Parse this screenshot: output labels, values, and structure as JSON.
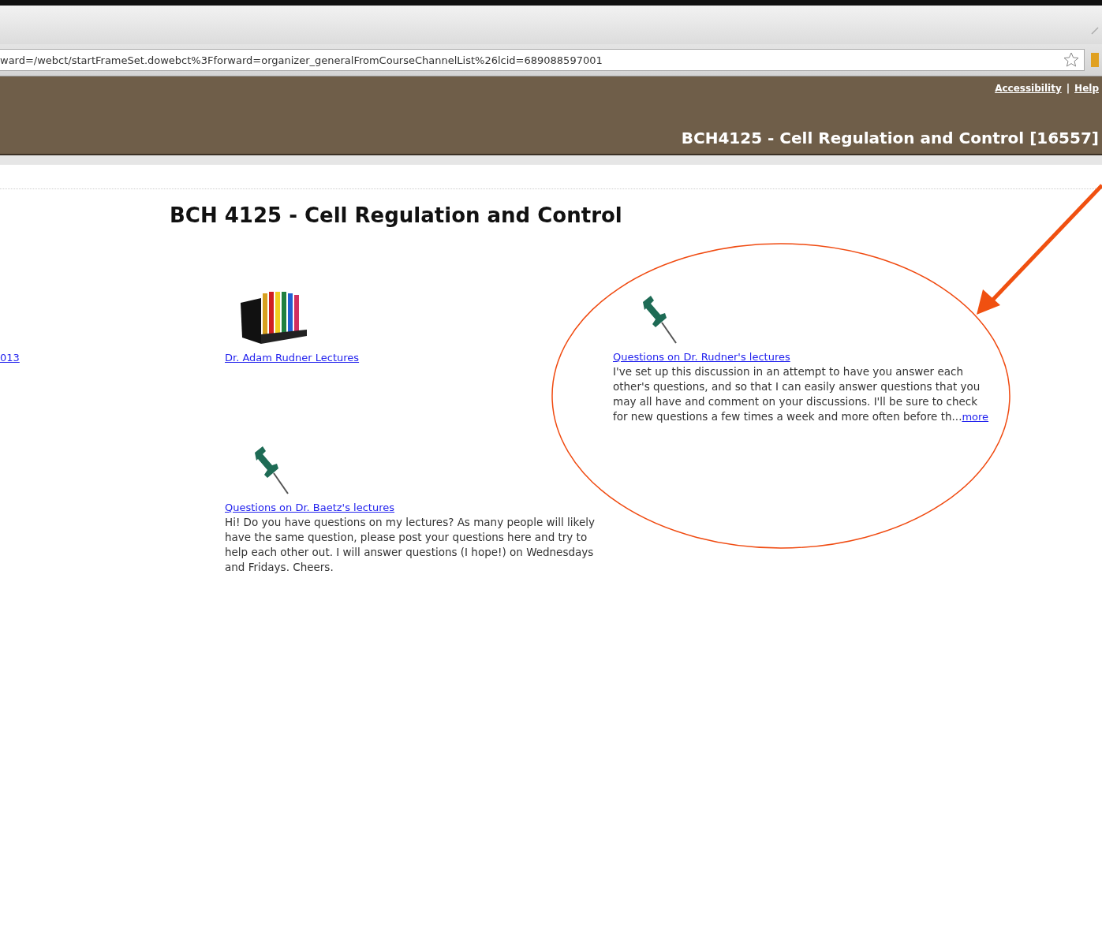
{
  "browser": {
    "address": "ward=/webct/startFrameSet.dowebct%3Fforward=organizer_generalFromCourseChannelList%26lcid=689088597001"
  },
  "header": {
    "links": [
      "Accessibility",
      "Help"
    ],
    "separator": "|",
    "course": "BCH4125 - Cell Regulation and Control [16557]"
  },
  "page_title": "BCH 4125 - Cell Regulation and Control",
  "items": [
    {
      "kind": "cut",
      "title": "013"
    },
    {
      "kind": "folder",
      "title": "Dr. Adam Rudner Lectures"
    },
    {
      "kind": "discussion",
      "title": "Questions on Dr. Rudner's lectures",
      "description": "I've set up this discussion in an attempt to have you answer each other's questions, and so that I can easily answer questions that you may all have and comment on your discussions. I'll be sure to check for new questions a few times a week and more often before th...",
      "more": "more"
    },
    {
      "kind": "discussion",
      "title": "Questions on Dr. Baetz's lectures",
      "description": "Hi! Do you have questions on my lectures? As many people will likely have the same question, please post your questions here and try to help each other out. I will answer questions (I hope!) on Wednesdays and Fridays. Cheers."
    }
  ],
  "annotation": {
    "highlight": true
  }
}
